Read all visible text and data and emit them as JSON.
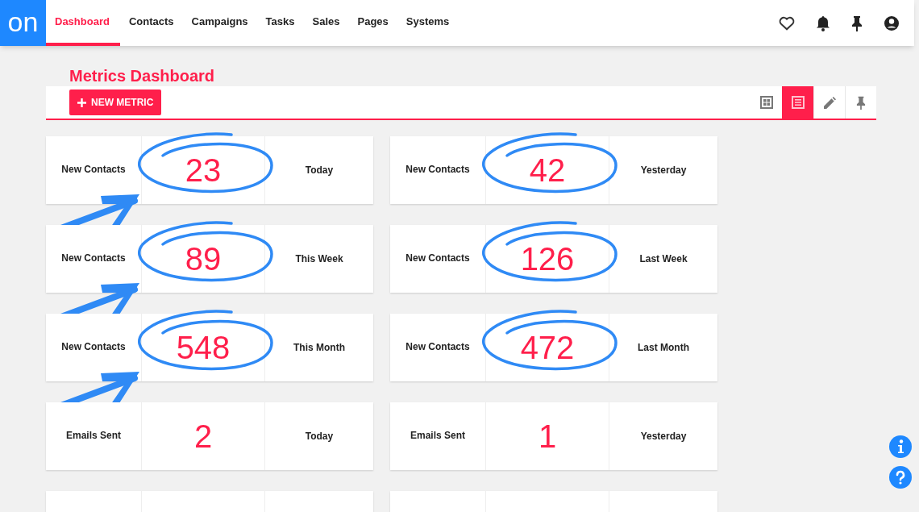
{
  "logo": "on",
  "nav": [
    {
      "label": "Dashboard",
      "selected": true
    },
    {
      "label": "Contacts",
      "selected": false
    },
    {
      "label": "Campaigns",
      "selected": false
    },
    {
      "label": "Tasks",
      "selected": false
    },
    {
      "label": "Sales",
      "selected": false
    },
    {
      "label": "Pages",
      "selected": false
    },
    {
      "label": "Systems",
      "selected": false
    }
  ],
  "page_title": "Metrics Dashboard",
  "new_button": "NEW METRIC",
  "view_buttons": [
    {
      "kind": "grid",
      "selected": false
    },
    {
      "kind": "list",
      "selected": true
    },
    {
      "kind": "edit",
      "selected": false
    },
    {
      "kind": "pin",
      "selected": false
    }
  ],
  "metrics": [
    {
      "label": "New Contacts",
      "value": "23",
      "period": "Today",
      "circled": true,
      "arrow": true
    },
    {
      "label": "New Contacts",
      "value": "42",
      "period": "Yesterday",
      "circled": true,
      "arrow": false
    },
    {
      "label": "New Contacts",
      "value": "89",
      "period": "This Week",
      "circled": true,
      "arrow": true
    },
    {
      "label": "New Contacts",
      "value": "126",
      "period": "Last Week",
      "circled": true,
      "arrow": false
    },
    {
      "label": "New Contacts",
      "value": "548",
      "period": "This Month",
      "circled": true,
      "arrow": true
    },
    {
      "label": "New Contacts",
      "value": "472",
      "period": "Last Month",
      "circled": true,
      "arrow": false
    },
    {
      "label": "Emails Sent",
      "value": "2",
      "period": "Today",
      "circled": false,
      "arrow": false
    },
    {
      "label": "Emails Sent",
      "value": "1",
      "period": "Yesterday",
      "circled": false,
      "arrow": false
    }
  ]
}
